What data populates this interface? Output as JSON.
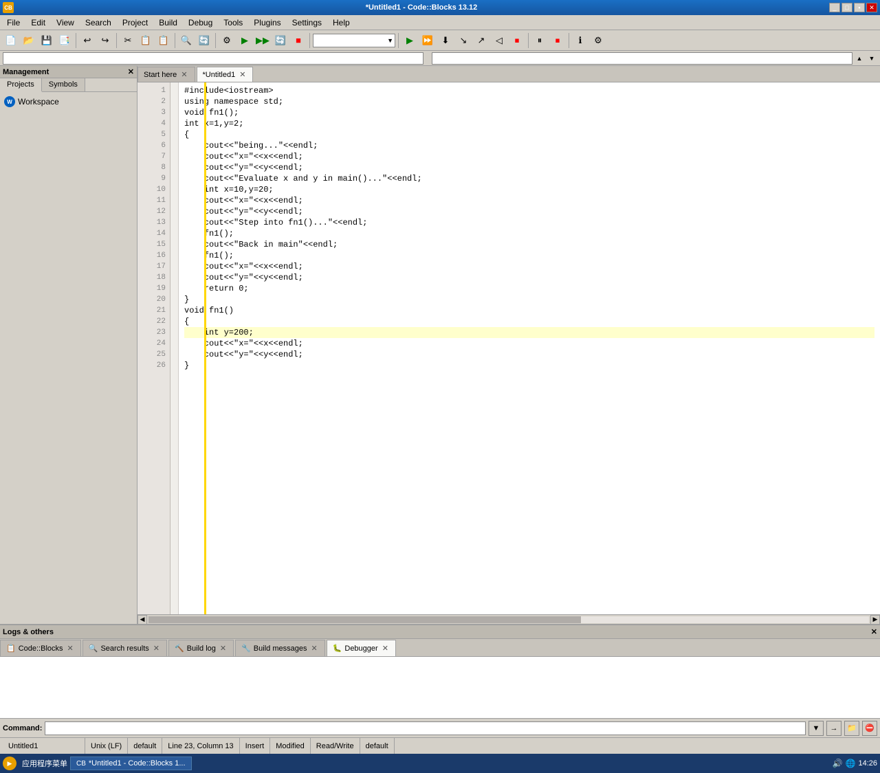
{
  "window": {
    "title": "*Untitled1 - Code::Blocks 13.12",
    "app_icon": "CB"
  },
  "menubar": {
    "items": [
      "File",
      "Edit",
      "View",
      "Search",
      "Project",
      "Build",
      "Debug",
      "Tools",
      "Plugins",
      "Settings",
      "Help"
    ]
  },
  "sidebar": {
    "header": "Management",
    "tabs": [
      "Projects",
      "Symbols"
    ],
    "active_tab": "Projects",
    "workspace_label": "Workspace"
  },
  "editor": {
    "tabs": [
      {
        "label": "Start here",
        "closable": true,
        "active": false
      },
      {
        "label": "*Untitled1",
        "closable": true,
        "active": true
      }
    ],
    "code_lines": [
      {
        "num": 1,
        "text": "#include<iostream>"
      },
      {
        "num": 2,
        "text": "using namespace std;"
      },
      {
        "num": 3,
        "text": "void fn1();"
      },
      {
        "num": 4,
        "text": "int x=1,y=2;"
      },
      {
        "num": 5,
        "text": "{"
      },
      {
        "num": 6,
        "text": "    cout<<\"being...\"<<endl;"
      },
      {
        "num": 7,
        "text": "    cout<<\"x=\"<<x<<endl;"
      },
      {
        "num": 8,
        "text": "    cout<<\"y=\"<<y<<endl;"
      },
      {
        "num": 9,
        "text": "    cout<<\"Evaluate x and y in main()...\"<<endl;"
      },
      {
        "num": 10,
        "text": "    int x=10,y=20;"
      },
      {
        "num": 11,
        "text": "    cout<<\"x=\"<<x<<endl;"
      },
      {
        "num": 12,
        "text": "    cout<<\"y=\"<<y<<endl;"
      },
      {
        "num": 13,
        "text": "    cout<<\"Step into fn1()...\"<<endl;"
      },
      {
        "num": 14,
        "text": "    fn1();"
      },
      {
        "num": 15,
        "text": "    cout<<\"Back in main\"<<endl;"
      },
      {
        "num": 16,
        "text": "    fn1();"
      },
      {
        "num": 17,
        "text": "    cout<<\"x=\"<<x<<endl;"
      },
      {
        "num": 18,
        "text": "    cout<<\"y=\"<<y<<endl;"
      },
      {
        "num": 19,
        "text": "    return 0;"
      },
      {
        "num": 20,
        "text": "}"
      },
      {
        "num": 21,
        "text": "void fn1()"
      },
      {
        "num": 22,
        "text": "{"
      },
      {
        "num": 23,
        "text": "    int y=200;",
        "highlight": true
      },
      {
        "num": 24,
        "text": "    cout<<\"x=\"<<x<<endl;"
      },
      {
        "num": 25,
        "text": "    cout<<\"y=\"<<y<<endl;"
      },
      {
        "num": 26,
        "text": "}"
      }
    ]
  },
  "bottom_panel": {
    "header": "Logs & others",
    "tabs": [
      {
        "label": "Code::Blocks",
        "icon": "📋",
        "closable": true,
        "active": false
      },
      {
        "label": "Search results",
        "icon": "🔍",
        "closable": true,
        "active": false
      },
      {
        "label": "Build log",
        "icon": "🔨",
        "closable": true,
        "active": false
      },
      {
        "label": "Build messages",
        "icon": "🔧",
        "closable": true,
        "active": false
      },
      {
        "label": "Debugger",
        "icon": "🐛",
        "closable": true,
        "active": true
      }
    ],
    "command_label": "Command:"
  },
  "statusbar": {
    "file": "Untitled1",
    "line_ending": "Unix (LF)",
    "language": "default",
    "position": "Line 23, Column 13",
    "mode": "Insert",
    "modified": "Modified",
    "access": "Read/Write",
    "encoding": "default"
  },
  "taskbar": {
    "start_label": "应用程序菜单",
    "items": [
      {
        "label": "*Untitled1 - Code::Blocks 1..."
      }
    ],
    "time": "14:26"
  },
  "toolbar": {
    "combo1_value": "",
    "combo2_value": ""
  }
}
